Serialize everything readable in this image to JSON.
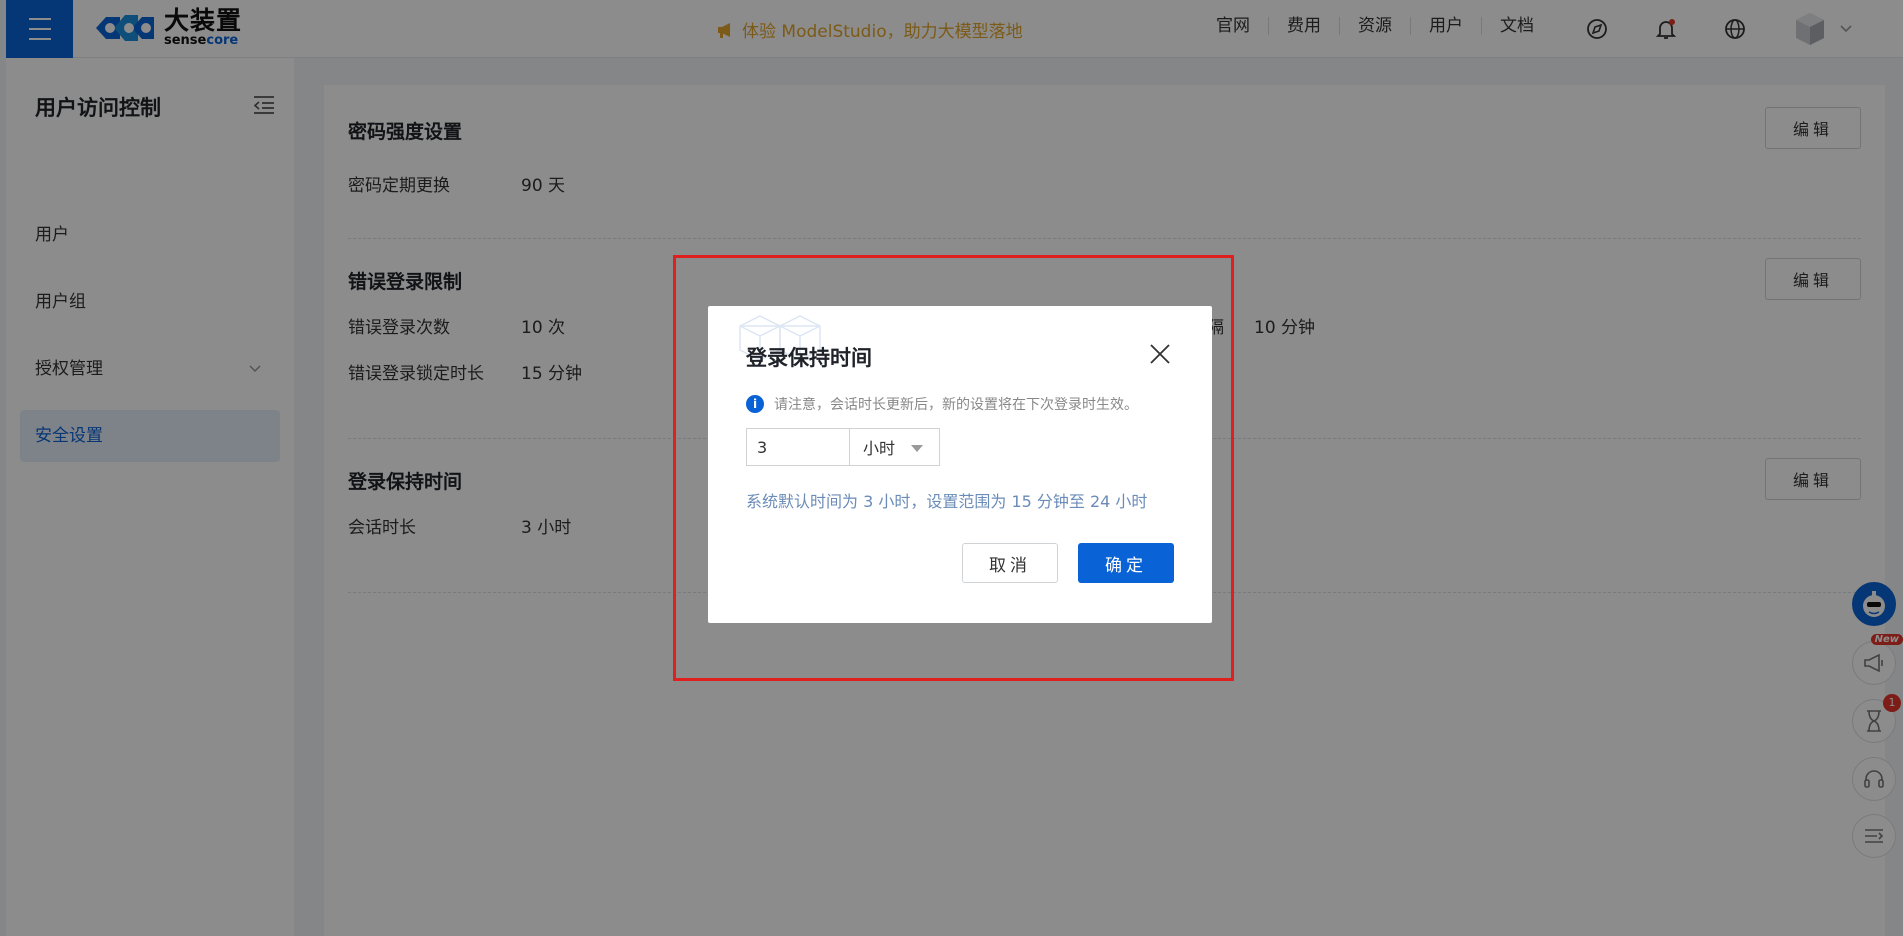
{
  "header": {
    "logo_cn": "大装置",
    "logo_en_a": "sense",
    "logo_en_b": "core",
    "promo_text": "体验 ModelStudio，助力大模型落地",
    "nav": [
      "官网",
      "费用",
      "资源",
      "用户",
      "文档"
    ]
  },
  "sidebar": {
    "title": "用户访问控制",
    "items": [
      {
        "label": "用户"
      },
      {
        "label": "用户组"
      },
      {
        "label": "授权管理"
      },
      {
        "label": "安全设置"
      }
    ]
  },
  "main": {
    "sections": [
      {
        "title": "密码强度设置",
        "edit_label": "编辑",
        "rows": [
          {
            "key": "密码定期更换",
            "value": "90 天"
          }
        ]
      },
      {
        "title": "错误登录限制",
        "edit_label": "编辑",
        "rows": [
          {
            "key": "错误登录次数",
            "value": "10 次"
          },
          {
            "key": "错误登录锁定时长",
            "value": "15 分钟"
          }
        ],
        "partial_key_suffix": "间隔",
        "partial_value": "10 分钟"
      },
      {
        "title": "登录保持时间",
        "edit_label": "编辑",
        "rows": [
          {
            "key": "会话时长",
            "value": "3 小时"
          }
        ]
      }
    ]
  },
  "float_buttons": {
    "new_badge": "New",
    "pending_count": "1"
  },
  "modal": {
    "title": "登录保持时间",
    "notice": "请注意，会话时长更新后，新的设置将在下次登录时生效。",
    "value": "3",
    "unit": "小时",
    "hint": "系统默认时间为 3 小时，设置范围为 15 分钟至 24 小时",
    "cancel_label": "取消",
    "ok_label": "确定"
  },
  "colors": {
    "primary": "#0a63d6",
    "promo": "#e2a42a",
    "highlight": "#e0201f"
  }
}
